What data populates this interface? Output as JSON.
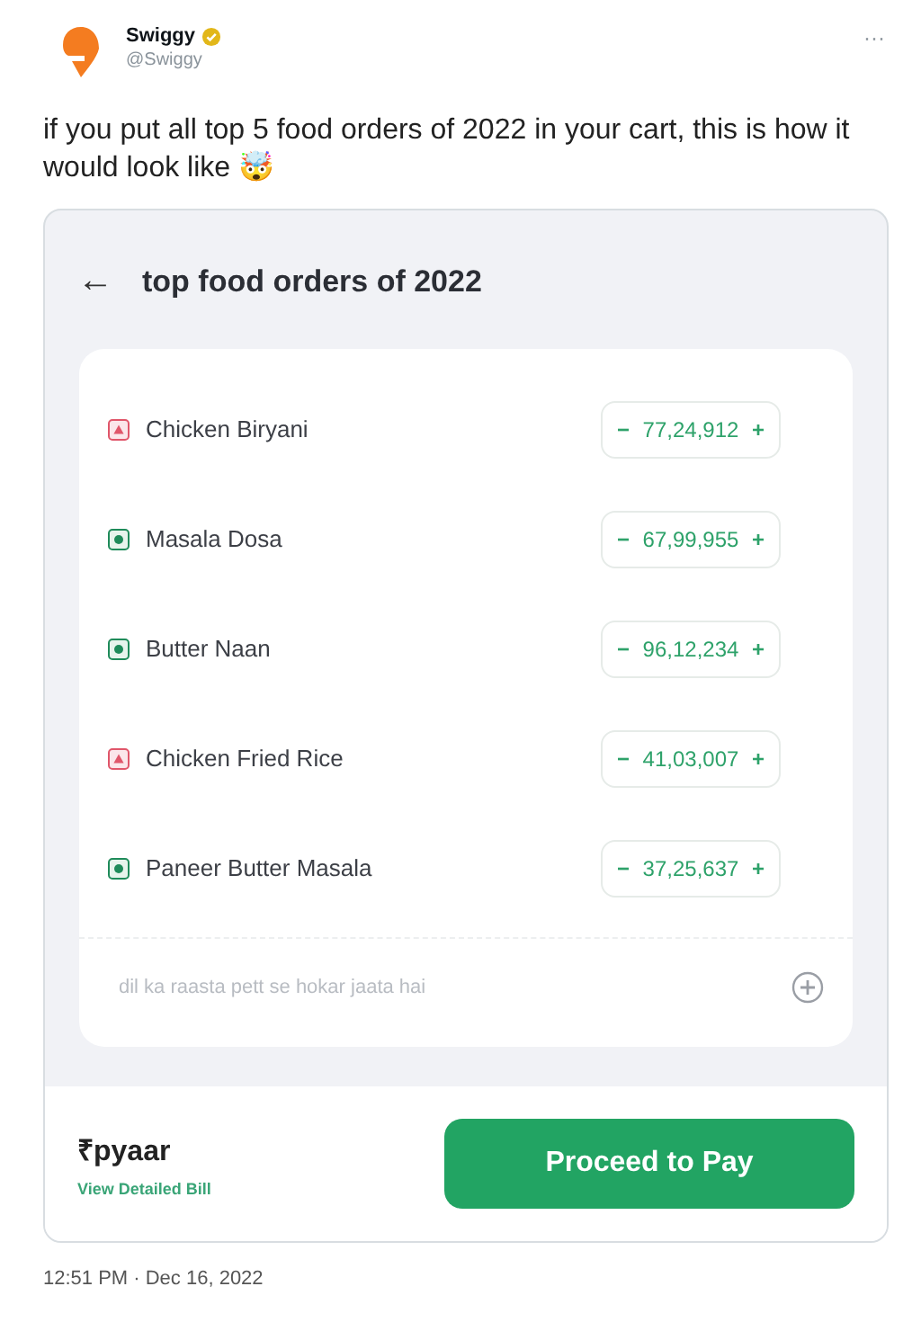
{
  "tweet": {
    "name": "Swiggy",
    "handle": "@Swiggy",
    "more": "···",
    "text": "if you put all top 5 food orders of 2022 in your cart, this is how it would look like 🤯",
    "time": "12:51 PM · Dec 16, 2022"
  },
  "app": {
    "back": "←",
    "title": "top food orders of 2022",
    "items": [
      {
        "name": "Chicken Biryani",
        "kind": "nonveg",
        "minus": "−",
        "qty": "77,24,912",
        "plus": "+"
      },
      {
        "name": "Masala Dosa",
        "kind": "veg",
        "minus": "−",
        "qty": "67,99,955",
        "plus": "+"
      },
      {
        "name": "Butter Naan",
        "kind": "veg",
        "minus": "−",
        "qty": "96,12,234",
        "plus": "+"
      },
      {
        "name": "Chicken Fried Rice",
        "kind": "nonveg",
        "minus": "−",
        "qty": "41,03,007",
        "plus": "+"
      },
      {
        "name": "Paneer Butter Masala",
        "kind": "veg",
        "minus": "−",
        "qty": "37,25,637",
        "plus": "+"
      }
    ],
    "note_placeholder": "dil ka raasta pett se hokar jaata hai",
    "total": "₹pyaar",
    "bill_link": "View Detailed Bill",
    "pay": "Proceed to Pay"
  }
}
